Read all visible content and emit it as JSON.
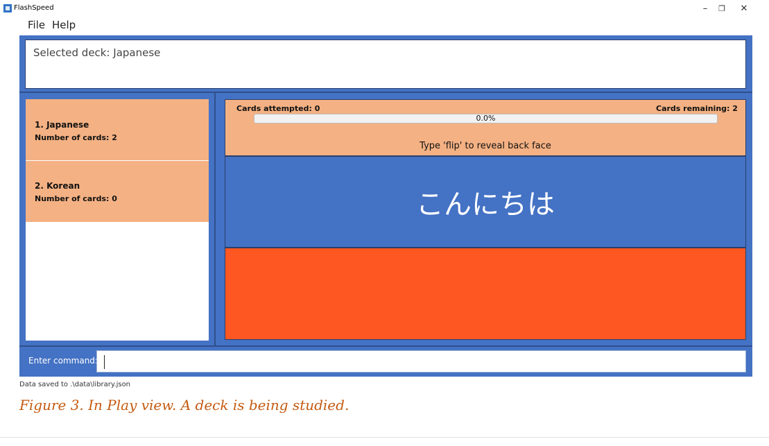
{
  "window": {
    "title": "FlashSpeed",
    "minimize_glyph": "–",
    "restore_glyph": "❐",
    "close_glyph": "✕"
  },
  "menu": [
    "File",
    "Help"
  ],
  "result_display": "Selected deck: Japanese",
  "decks": [
    {
      "label": "1.  Japanese",
      "count": "Number of cards: 2"
    },
    {
      "label": "2.  Korean",
      "count": "Number of cards: 0"
    }
  ],
  "play": {
    "cards_attempted": "Cards attempted: 0",
    "cards_remaining": "Cards remaining: 2",
    "progress_label": "0.0%",
    "progress_value": 0.0,
    "instruction": "Type 'flip' to reveal back face",
    "front_face": "こんにちは",
    "back_face": ""
  },
  "command": {
    "label": "Enter command:",
    "value": ""
  },
  "status_bar": "Data saved to .\\data\\library.json",
  "caption": "Figure 3. In Play view. A deck is being studied.",
  "colors": {
    "frame_blue": "#4472c4",
    "peach": "#f4b183",
    "back_orange": "#ff5722",
    "caption_orange": "#c55a11"
  }
}
